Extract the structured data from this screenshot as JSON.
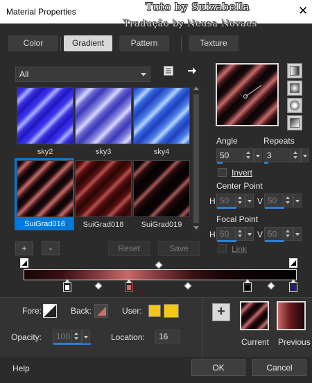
{
  "window": {
    "title": "Material Properties",
    "watermark_line1": "Tuto by Suizabella",
    "watermark_line2": "Tradução by Neusa Novaes",
    "close_glyph": "✕"
  },
  "tabs": [
    {
      "label": "Color",
      "active": false
    },
    {
      "label": "Gradient",
      "active": true
    },
    {
      "label": "Pattern",
      "active": false
    },
    {
      "label": "Texture",
      "active": false
    }
  ],
  "library": {
    "category": "All",
    "icons": {
      "list": "list-icon",
      "next": "arrow-right-icon"
    },
    "swatches": [
      {
        "name": "sky2",
        "selected": false
      },
      {
        "name": "sky3",
        "selected": false
      },
      {
        "name": "sky4",
        "selected": false
      },
      {
        "name": "SuiGrad016",
        "selected": true
      },
      {
        "name": "SuiGrad018",
        "selected": false
      },
      {
        "name": "SuiGrad019",
        "selected": false
      }
    ],
    "buttons": {
      "add": "+",
      "remove": "-",
      "reset": "Reset",
      "save": "Save"
    }
  },
  "settings": {
    "angle_label": "Angle",
    "angle_value": "50",
    "repeats_label": "Repeats",
    "repeats_value": "3",
    "invert_label": "Invert",
    "invert_checked": false,
    "focal_center_label": "Center Point",
    "focal_point_label": "Focal Point",
    "h_label": "H",
    "v_label": "V",
    "center_h": "50",
    "center_v": "50",
    "focal_h": "50",
    "focal_v": "50",
    "link_label": "Link",
    "link_checked": false
  },
  "editor": {
    "fore_label": "Fore:",
    "back_label": "Back:",
    "user_label": "User:",
    "opacity_label": "Opacity:",
    "opacity_value": "100",
    "location_label": "Location:",
    "location_value": "16",
    "add_glyph": "+",
    "current_label": "Current",
    "previous_label": "Previous",
    "colors": {
      "user": "#f5c518",
      "stop_pink": "#c87070",
      "stop_blue": "#1a1aa0",
      "accent": "#2d7fd3"
    }
  },
  "footer": {
    "help": "Help",
    "ok": "OK",
    "cancel": "Cancel"
  }
}
